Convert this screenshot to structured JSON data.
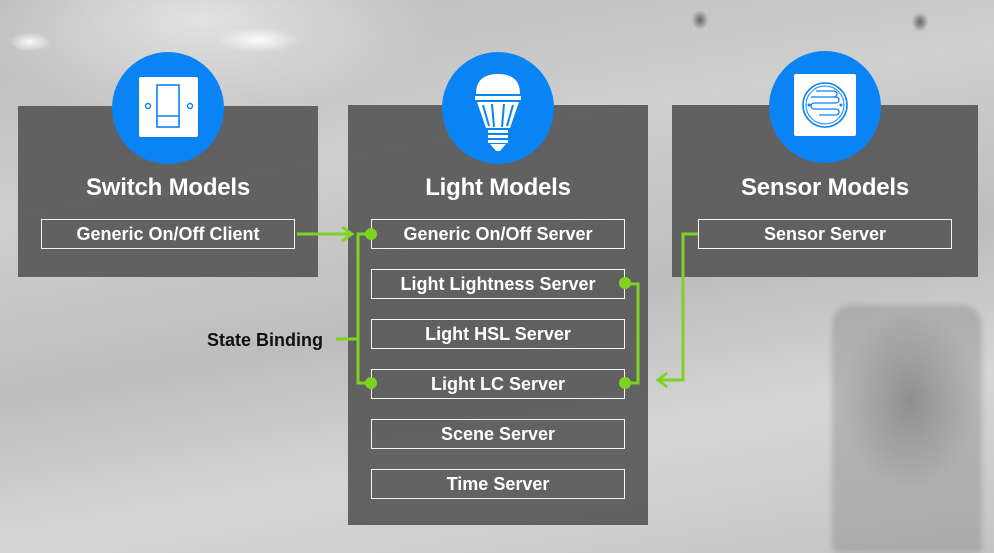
{
  "colors": {
    "icon_circle": "#0a84f5",
    "connector": "#7ed321",
    "panel": "#555555",
    "text": "#ffffff",
    "label_text": "#111111"
  },
  "groups": [
    {
      "id": "switch",
      "title": "Switch Models",
      "icon": "wall-switch-icon",
      "items": [
        "Generic On/Off Client"
      ]
    },
    {
      "id": "light",
      "title": "Light Models",
      "icon": "light-bulb-icon",
      "items": [
        "Generic On/Off Server",
        "Light Lightness Server",
        "Light HSL Server",
        "Light LC Server",
        "Scene Server",
        "Time Server"
      ]
    },
    {
      "id": "sensor",
      "title": "Sensor Models",
      "icon": "sensor-icon",
      "items": [
        "Sensor Server"
      ]
    }
  ],
  "annotations": {
    "state_binding": "State Binding"
  },
  "connections": [
    {
      "from": "Generic On/Off Client",
      "to": "Generic On/Off Server",
      "type": "arrow"
    },
    {
      "from": "Generic On/Off Server",
      "to": "Light LC Server",
      "type": "state-binding"
    },
    {
      "from": "Light Lightness Server",
      "to": "Light LC Server",
      "type": "state-binding"
    },
    {
      "from": "Sensor Server",
      "to": "Light LC Server",
      "type": "arrow"
    }
  ]
}
